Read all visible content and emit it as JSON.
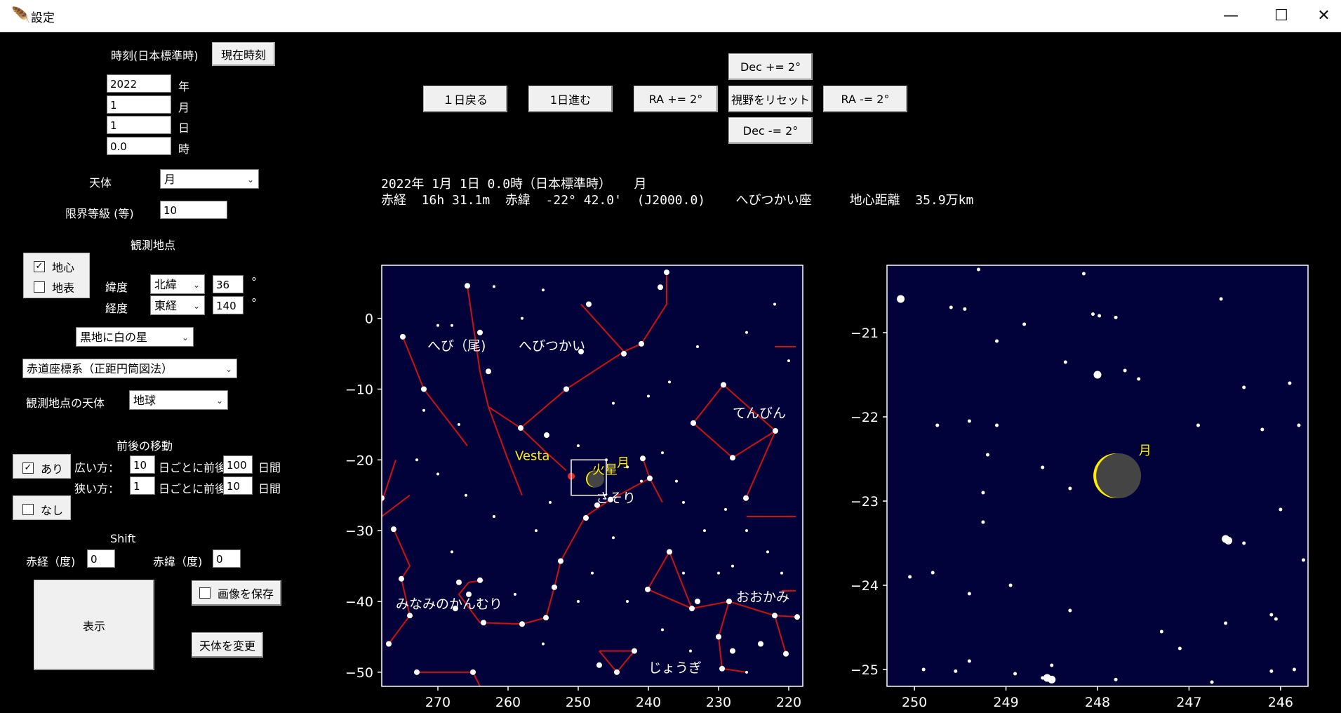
{
  "window": {
    "title": "設定",
    "app_icon": "feather-icon",
    "minimize": "—",
    "maximize": "☐",
    "close": "✕"
  },
  "left": {
    "time_label": "時刻(日本標準時)",
    "now_button": "現在時刻",
    "year": {
      "value": "2022",
      "unit": "年"
    },
    "month": {
      "value": "1",
      "unit": "月"
    },
    "day": {
      "value": "1",
      "unit": "日"
    },
    "hour": {
      "value": "0.0",
      "unit": "時"
    },
    "body_label": "天体",
    "body_value": "月",
    "mag_label": "限界等級 (等)",
    "mag_value": "10",
    "obs_point_label": "観測地点",
    "geocentric": {
      "label": "地心",
      "checked": true
    },
    "topocentric": {
      "label": "地表",
      "checked": false
    },
    "lat_label": "緯度",
    "lat_dir": "北緯",
    "lat_value": "36",
    "lat_unit": "°",
    "lon_label": "経度",
    "lon_dir": "東経",
    "lon_value": "140",
    "lon_unit": "°",
    "style_value": "黒地に白の星",
    "coord_value": "赤道座標系（正距円筒図法）",
    "obs_body_label": "観測地点の天体",
    "obs_body_value": "地球",
    "move_label": "前後の移動",
    "move_yes": {
      "label": "あり",
      "checked": true
    },
    "move_no": {
      "label": "なし",
      "checked": false
    },
    "wide_label": "広い方：",
    "wide_step": "10",
    "wide_mid": "日ごとに前後",
    "wide_range": "100",
    "wide_unit": "日間",
    "narrow_label": "狭い方：",
    "narrow_step": "1",
    "narrow_mid": "日ごとに前後",
    "narrow_range": "10",
    "narrow_unit": "日間",
    "shift_label": "Shift",
    "ra_shift_label": "赤経（度)",
    "ra_shift_value": "0",
    "dec_shift_label": "赤緯（度)",
    "dec_shift_value": "0",
    "show_button": "表示",
    "save_image": {
      "label": "画像を保存",
      "checked": false
    },
    "change_body_button": "天体を変更"
  },
  "toolbar": {
    "back_day": "１日戻る",
    "fwd_day": "1日進む",
    "ra_plus": "RA += 2°",
    "dec_plus": "Dec += 2°",
    "reset": "視野をリセット",
    "dec_minus": "Dec -= 2°",
    "ra_minus": "RA -= 2°"
  },
  "info": {
    "line1": "2022年 1月 1日 0.0時（日本標準時）   月",
    "line2": "赤経  16h 31.1m  赤緯  -22° 42.0'  (J2000.0)    へびつかい座     地心距離  35.9万km"
  },
  "colors": {
    "sky": "#02023a",
    "line": "#d01010",
    "label": "#ffffff",
    "highlight": "#ffee00",
    "planet": "#ff2020"
  },
  "chart_data": [
    {
      "type": "scatter",
      "title": "",
      "xlim": [
        278,
        218
      ],
      "ylim": [
        -52,
        7.5
      ],
      "xticks": [
        270,
        260,
        250,
        240,
        230,
        220
      ],
      "yticks": [
        0,
        -10,
        -20,
        -30,
        -40,
        -50
      ],
      "constellation_labels": [
        {
          "text": "へび（尾)",
          "x": 271.5,
          "y": -4.5
        },
        {
          "text": "へびつかい",
          "x": 258.5,
          "y": -4.5
        },
        {
          "text": "てんびん",
          "x": 228,
          "y": -14
        },
        {
          "text": "さそり",
          "x": 247.5,
          "y": -26
        },
        {
          "text": "おおかみ",
          "x": 227.5,
          "y": -40
        },
        {
          "text": "じょうぎ",
          "x": 240,
          "y": -50
        },
        {
          "text": "みなみのかんむり",
          "x": 276,
          "y": -41
        }
      ],
      "object_labels": [
        {
          "text": "Vesta",
          "x": 259,
          "y": -20,
          "color": "highlight"
        },
        {
          "text": "火星",
          "x": 248,
          "y": -22,
          "color": "highlight"
        },
        {
          "text": "月",
          "x": 244.5,
          "y": -21,
          "color": "highlight"
        }
      ],
      "moon": {
        "ra": 247.7,
        "dec": -22.7
      },
      "mars": {
        "ra": 251,
        "dec": -22.3
      },
      "view_box": {
        "x": [
          251,
          246
        ],
        "y": [
          -20,
          -25
        ]
      },
      "stars": [
        [
          275,
          -2.6
        ],
        [
          272,
          -10
        ],
        [
          265.8,
          4.6
        ],
        [
          264,
          -2
        ],
        [
          262.8,
          -7.5
        ],
        [
          258.2,
          -15.5
        ],
        [
          254.5,
          -16.5
        ],
        [
          251.7,
          -10
        ],
        [
          249.6,
          -4.7
        ],
        [
          248.5,
          2
        ],
        [
          241,
          -3.6
        ],
        [
          243.5,
          -5
        ],
        [
          237.4,
          6.5
        ],
        [
          238.3,
          4.4
        ],
        [
          233.6,
          -14.8
        ],
        [
          229.3,
          -9.4
        ],
        [
          226.1,
          -25.4
        ],
        [
          221.9,
          -15.9
        ],
        [
          228,
          -19.7
        ],
        [
          240.8,
          -19.8
        ],
        [
          239.8,
          -22.6
        ],
        [
          245.4,
          -25.6
        ],
        [
          247.3,
          -26.4
        ],
        [
          248.9,
          -28.2
        ],
        [
          252.5,
          -34.3
        ],
        [
          253.4,
          -38
        ],
        [
          254.6,
          -42.3
        ],
        [
          258,
          -43.2
        ],
        [
          263.5,
          -43
        ],
        [
          265.6,
          -39
        ],
        [
          267,
          -37.3
        ],
        [
          264,
          -37
        ],
        [
          267.5,
          -41
        ],
        [
          276.3,
          -29.8
        ],
        [
          278,
          -25.4
        ],
        [
          275.2,
          -36.8
        ],
        [
          274,
          -42
        ],
        [
          277,
          -46
        ],
        [
          273,
          -50
        ],
        [
          265,
          -50
        ],
        [
          237,
          -33
        ],
        [
          233.8,
          -41
        ],
        [
          228.5,
          -40
        ],
        [
          222,
          -42
        ],
        [
          220.4,
          -47.4
        ],
        [
          224,
          -46
        ],
        [
          228,
          -47
        ],
        [
          233,
          -40
        ],
        [
          240.1,
          -38.3
        ],
        [
          230,
          -45
        ],
        [
          229.5,
          -49.5
        ],
        [
          218.8,
          -42.2
        ],
        [
          244.5,
          -50
        ],
        [
          247,
          -49
        ],
        [
          242,
          -47
        ]
      ],
      "faint_stars": [
        [
          270,
          -1
        ],
        [
          268,
          -1
        ],
        [
          258,
          0
        ],
        [
          255,
          4
        ],
        [
          262,
          4.5
        ],
        [
          250,
          -18
        ],
        [
          246,
          -20
        ],
        [
          243,
          -21
        ],
        [
          241,
          -23
        ],
        [
          238,
          -19
        ],
        [
          236,
          -23
        ],
        [
          235,
          -26
        ],
        [
          232,
          -30
        ],
        [
          229,
          -27
        ],
        [
          226,
          -30
        ],
        [
          223,
          -33
        ],
        [
          221,
          -36
        ],
        [
          235,
          -36
        ],
        [
          228,
          -35
        ],
        [
          245,
          -31
        ],
        [
          248,
          -36
        ],
        [
          243,
          -40
        ],
        [
          256,
          -30
        ],
        [
          254,
          -26
        ],
        [
          262,
          -28
        ],
        [
          266,
          -25
        ],
        [
          270,
          -22
        ],
        [
          273,
          -20
        ],
        [
          268,
          -33
        ],
        [
          259,
          -39
        ],
        [
          250,
          -40
        ],
        [
          255,
          -46
        ],
        [
          238,
          -44
        ],
        [
          234,
          -47
        ],
        [
          226,
          -50
        ],
        [
          230,
          -36
        ],
        [
          237,
          -9
        ],
        [
          233,
          -4
        ],
        [
          226,
          -2
        ],
        [
          222,
          2
        ],
        [
          220,
          -6
        ],
        [
          267,
          -15
        ],
        [
          272,
          -13
        ],
        [
          245,
          -12
        ],
        [
          240,
          -11
        ]
      ],
      "lines": [
        [
          [
            275,
            -2.6
          ],
          [
            272,
            -10
          ],
          [
            265.8,
            -18
          ]
        ],
        [
          [
            265.8,
            4.6
          ],
          [
            264,
            -7.5
          ],
          [
            262.8,
            -12.5
          ],
          [
            258.2,
            -15.5
          ],
          [
            251.7,
            -10
          ],
          [
            243.5,
            -4.7
          ],
          [
            241,
            -3.6
          ],
          [
            237.4,
            2
          ],
          [
            237.4,
            6.5
          ]
        ],
        [
          [
            249.6,
            2
          ],
          [
            243.5,
            -4.7
          ]
        ],
        [
          [
            258.2,
            -15.5
          ],
          [
            254.5,
            -19
          ],
          [
            251.7,
            -21.5
          ]
        ],
        [
          [
            262.8,
            -12.5
          ],
          [
            260,
            -20
          ],
          [
            258,
            -25
          ]
        ],
        [
          [
            233.6,
            -14.8
          ],
          [
            229.3,
            -9.4
          ],
          [
            221.9,
            -15.9
          ],
          [
            228,
            -19.7
          ],
          [
            233.6,
            -14.8
          ]
        ],
        [
          [
            221.9,
            -15.9
          ],
          [
            226.1,
            -25.4
          ]
        ],
        [
          [
            239.8,
            -22.6
          ],
          [
            245.4,
            -25.6
          ],
          [
            249,
            -28
          ],
          [
            252.5,
            -34.3
          ],
          [
            253.4,
            -38
          ],
          [
            254.6,
            -42.3
          ],
          [
            258,
            -43.2
          ],
          [
            264,
            -43
          ],
          [
            267,
            -39
          ],
          [
            265.6,
            -37.3
          ],
          [
            263.5,
            -37
          ]
        ],
        [
          [
            239.8,
            -22.6
          ],
          [
            238,
            -26
          ]
        ],
        [
          [
            240.8,
            -19.8
          ],
          [
            239.8,
            -22.6
          ]
        ],
        [
          [
            240.1,
            -38.3
          ],
          [
            237,
            -33
          ],
          [
            233.8,
            -41
          ],
          [
            240.1,
            -38.3
          ]
        ],
        [
          [
            233.8,
            -41
          ],
          [
            228.5,
            -40
          ],
          [
            222,
            -42
          ],
          [
            220.4,
            -47.4
          ]
        ],
        [
          [
            228.5,
            -40
          ],
          [
            230,
            -45
          ],
          [
            229.5,
            -49.5
          ],
          [
            226,
            -50
          ]
        ],
        [
          [
            276.3,
            -29.8
          ],
          [
            274,
            -35
          ],
          [
            275.2,
            -36.8
          ],
          [
            274,
            -42
          ],
          [
            277,
            -46
          ]
        ],
        [
          [
            274,
            -25
          ],
          [
            278,
            -28
          ]
        ],
        [
          [
            273,
            -50
          ],
          [
            265,
            -50
          ],
          [
            264,
            -52
          ]
        ],
        [
          [
            247,
            -47
          ],
          [
            244.5,
            -50
          ],
          [
            242,
            -47
          ],
          [
            247,
            -47
          ]
        ],
        [
          [
            222,
            -42
          ],
          [
            218.8,
            -42.2
          ]
        ],
        [
          [
            226,
            -28
          ],
          [
            219,
            -28
          ]
        ],
        [
          [
            221,
            -38.5
          ],
          [
            219,
            -38.5
          ]
        ],
        [
          [
            276,
            -20
          ],
          [
            278,
            -26
          ]
        ],
        [
          [
            219,
            -4
          ],
          [
            222,
            -4
          ]
        ]
      ]
    },
    {
      "type": "scatter",
      "title": "",
      "xlim": [
        250.3,
        245.7
      ],
      "ylim": [
        -25.2,
        -20.2
      ],
      "xticks": [
        250,
        249,
        248,
        247,
        246
      ],
      "yticks": [
        -21,
        -22,
        -23,
        -24,
        -25
      ],
      "object_labels": [
        {
          "text": "月",
          "x": 247.55,
          "y": -22.45,
          "color": "highlight"
        }
      ],
      "moon": {
        "ra": 247.8,
        "dec": -22.7
      },
      "stars": [
        [
          250.15,
          -20.6
        ],
        [
          248.0,
          -21.5
        ],
        [
          246.6,
          -23.45
        ],
        [
          246.57,
          -23.47
        ],
        [
          248.55,
          -25.1
        ],
        [
          248.5,
          -25.12
        ]
      ],
      "faint_stars": [
        [
          249.3,
          -20.25
        ],
        [
          248.15,
          -20.3
        ],
        [
          249.6,
          -20.7
        ],
        [
          249.45,
          -20.72
        ],
        [
          248.05,
          -20.78
        ],
        [
          247.98,
          -20.8
        ],
        [
          247.8,
          -20.82
        ],
        [
          248.8,
          -20.9
        ],
        [
          249.1,
          -21.1
        ],
        [
          246.65,
          -20.6
        ],
        [
          248.35,
          -21.35
        ],
        [
          247.7,
          -21.45
        ],
        [
          247.55,
          -21.55
        ],
        [
          246.4,
          -21.65
        ],
        [
          245.9,
          -21.6
        ],
        [
          249.4,
          -22.05
        ],
        [
          249.1,
          -22.1
        ],
        [
          249.75,
          -22.1
        ],
        [
          246.9,
          -22.1
        ],
        [
          246.2,
          -22.15
        ],
        [
          245.8,
          -22.1
        ],
        [
          249.2,
          -22.45
        ],
        [
          248.6,
          -22.6
        ],
        [
          248.3,
          -22.85
        ],
        [
          249.25,
          -22.9
        ],
        [
          246.0,
          -23.1
        ],
        [
          249.25,
          -23.25
        ],
        [
          246.4,
          -23.5
        ],
        [
          245.75,
          -23.7
        ],
        [
          250.05,
          -23.9
        ],
        [
          249.8,
          -23.85
        ],
        [
          249.4,
          -24.1
        ],
        [
          248.95,
          -24.0
        ],
        [
          248.3,
          -24.3
        ],
        [
          246.1,
          -24.35
        ],
        [
          246.05,
          -24.4
        ],
        [
          246.6,
          -24.45
        ],
        [
          247.3,
          -24.55
        ],
        [
          247.1,
          -24.75
        ],
        [
          249.4,
          -24.9
        ],
        [
          248.5,
          -24.95
        ],
        [
          248.6,
          -25.1
        ],
        [
          249.9,
          -25.0
        ],
        [
          249.55,
          -25.02
        ],
        [
          247.8,
          -25.12
        ],
        [
          246.1,
          -25.02
        ],
        [
          246.75,
          -25.15
        ],
        [
          245.85,
          -25.0
        ],
        [
          248.9,
          -25.05
        ]
      ]
    }
  ]
}
